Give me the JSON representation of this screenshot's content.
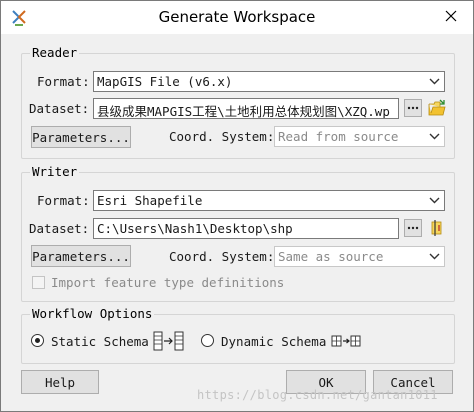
{
  "window": {
    "title": "Generate Workspace",
    "close_icon": "close-icon"
  },
  "reader": {
    "group_label": "Reader",
    "format_label": "Format:",
    "format_value": "MapGIS File (v6.x)",
    "dataset_label": "Dataset:",
    "dataset_value": "县级成果MAPGIS工程\\土地利用总体规划图\\XZQ.wp",
    "parameters_label": "Parameters...",
    "coord_label": "Coord. System:",
    "coord_value": "Read from source"
  },
  "writer": {
    "group_label": "Writer",
    "format_label": "Format:",
    "format_value": "Esri Shapefile",
    "dataset_label": "Dataset:",
    "dataset_value": "C:\\Users\\Nash1\\Desktop\\shp",
    "parameters_label": "Parameters...",
    "coord_label": "Coord. System:",
    "coord_value": "Same as source",
    "import_label": "Import feature type definitions",
    "import_checked": false
  },
  "workflow": {
    "group_label": "Workflow Options",
    "static_label": "Static Schema",
    "dynamic_label": "Dynamic Schema",
    "selected": "static"
  },
  "footer": {
    "help_label": "Help",
    "ok_label": "OK",
    "cancel_label": "Cancel",
    "watermark": "https://blog.csdn.net/gantan1011"
  },
  "colors": {
    "folder_icon": "#f2c230",
    "border": "#7a7a7a",
    "button_bg": "#e1e1e1"
  }
}
